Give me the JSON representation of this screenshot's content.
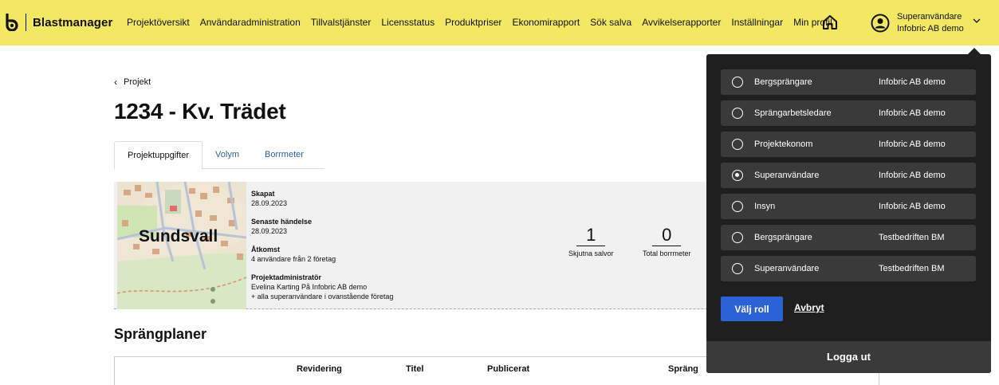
{
  "header": {
    "app_name": "Blastmanager",
    "nav": [
      "Projektöversikt",
      "Användaradministration",
      "Tillvalstjänster",
      "Licensstatus",
      "Produktpriser",
      "Ekonomirapport",
      "Sök salva",
      "Avvikelserapporter",
      "Inställningar",
      "Min profil"
    ],
    "user_role": "Superanvändare",
    "user_company": "Infobric AB demo"
  },
  "breadcrumb": "Projekt",
  "page_title": "1234 - Kv. Trädet",
  "tabs": [
    "Projektuppgifter",
    "Volym",
    "Borrmeter"
  ],
  "info": {
    "map_label": "Sundsvall",
    "created_label": "Skapat",
    "created_value": "28.09.2023",
    "last_event_label": "Senaste händelse",
    "last_event_value": "28.09.2023",
    "access_label": "Åtkomst",
    "access_value": "4 användare från 2 företag",
    "admin_label": "Projektadministratör",
    "admin_value": "Evelina Karting På Infobric AB demo",
    "admin_extra": "+ alla superanvändare i ovanstående företag"
  },
  "stats": [
    {
      "value": "1",
      "label": "Skjutna salvor"
    },
    {
      "value": "0",
      "label": "Total borrmeter"
    }
  ],
  "section_title": "Sprängplaner",
  "table_headers": [
    "Revidering",
    "Titel",
    "Publicerat",
    "Spräng"
  ],
  "dropdown": {
    "roles": [
      {
        "role": "Bergsprängare",
        "company": "Infobric AB demo",
        "selected": false
      },
      {
        "role": "Sprängarbetsledare",
        "company": "Infobric AB demo",
        "selected": false
      },
      {
        "role": "Projektekonom",
        "company": "Infobric AB demo",
        "selected": false
      },
      {
        "role": "Superanvändare",
        "company": "Infobric AB demo",
        "selected": true
      },
      {
        "role": "Insyn",
        "company": "Infobric AB demo",
        "selected": false
      },
      {
        "role": "Bergsprängare",
        "company": "Testbedriften BM",
        "selected": false
      },
      {
        "role": "Superanvändare",
        "company": "Testbedriften BM",
        "selected": false
      }
    ],
    "select_label": "Välj roll",
    "cancel_label": "Avbryt",
    "logout_label": "Logga ut"
  },
  "colors": {
    "topbar": "#f3e862",
    "dropdown": "#1f1f1f",
    "primary": "#2b62d6",
    "tab_link": "#2f5f9a"
  }
}
